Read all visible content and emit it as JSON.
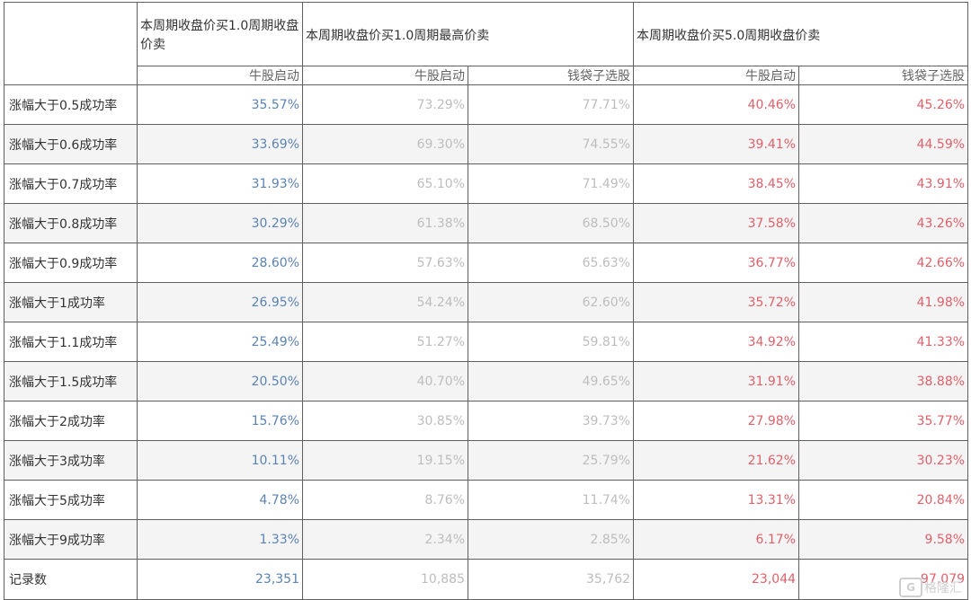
{
  "header": {
    "group1": "本周期收盘价买1.0周期收盘价卖",
    "group2": "本周期收盘价买1.0周期最高价卖",
    "group3": "本周期收盘价买5.0周期收盘价卖",
    "sub": [
      "牛股启动",
      "牛股启动",
      "钱袋子选股",
      "牛股启动",
      "钱袋子选股"
    ]
  },
  "rows": [
    {
      "label": "涨幅大于0.5成功率",
      "values": [
        "35.57%",
        "73.29%",
        "77.71%",
        "40.46%",
        "45.26%"
      ]
    },
    {
      "label": "涨幅大于0.6成功率",
      "values": [
        "33.69%",
        "69.30%",
        "74.55%",
        "39.41%",
        "44.59%"
      ]
    },
    {
      "label": "涨幅大于0.7成功率",
      "values": [
        "31.93%",
        "65.10%",
        "71.49%",
        "38.45%",
        "43.91%"
      ]
    },
    {
      "label": "涨幅大于0.8成功率",
      "values": [
        "30.29%",
        "61.38%",
        "68.50%",
        "37.58%",
        "43.26%"
      ]
    },
    {
      "label": "涨幅大于0.9成功率",
      "values": [
        "28.60%",
        "57.63%",
        "65.63%",
        "36.77%",
        "42.66%"
      ]
    },
    {
      "label": "涨幅大于1成功率",
      "values": [
        "26.95%",
        "54.24%",
        "62.60%",
        "35.72%",
        "41.98%"
      ]
    },
    {
      "label": "涨幅大于1.1成功率",
      "values": [
        "25.49%",
        "51.27%",
        "59.81%",
        "34.92%",
        "41.33%"
      ]
    },
    {
      "label": "涨幅大于1.5成功率",
      "values": [
        "20.50%",
        "40.70%",
        "49.65%",
        "31.91%",
        "38.88%"
      ]
    },
    {
      "label": "涨幅大于2成功率",
      "values": [
        "15.76%",
        "30.85%",
        "39.73%",
        "27.98%",
        "35.77%"
      ]
    },
    {
      "label": "涨幅大于3成功率",
      "values": [
        "10.11%",
        "19.15%",
        "25.79%",
        "21.62%",
        "30.23%"
      ]
    },
    {
      "label": "涨幅大于5成功率",
      "values": [
        "4.78%",
        "8.76%",
        "11.74%",
        "13.31%",
        "20.84%"
      ]
    },
    {
      "label": "涨幅大于9成功率",
      "values": [
        "1.33%",
        "2.34%",
        "2.85%",
        "6.17%",
        "9.58%"
      ]
    },
    {
      "label": "记录数",
      "values": [
        "23,351",
        "10,885",
        "35,762",
        "23,044",
        "97,079"
      ]
    }
  ],
  "colors": {
    "col1": "#5b83b4",
    "col2_3": "#bdbdbd",
    "col4_5": "#e0606a"
  },
  "watermark": {
    "text": "格隆汇",
    "logo": "G"
  }
}
